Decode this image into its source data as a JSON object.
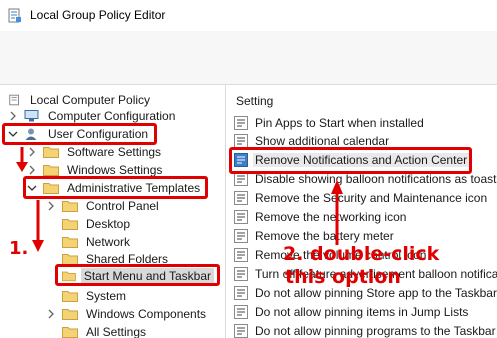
{
  "window": {
    "title": "Local Group Policy Editor",
    "app_icon": "policy-editor-icon"
  },
  "tree": {
    "items": [
      {
        "label": "Local Computer Policy",
        "icon": "computer-policy-icon"
      },
      {
        "label": "Computer Configuration",
        "icon": "computer-icon"
      },
      {
        "label": "User Configuration",
        "icon": "user-icon"
      },
      {
        "label": "Software Settings",
        "icon": "folder-icon"
      },
      {
        "label": "Windows Settings",
        "icon": "folder-icon"
      },
      {
        "label": "Administrative Templates",
        "icon": "folder-icon"
      },
      {
        "label": "Control Panel",
        "icon": "folder-icon"
      },
      {
        "label": "Desktop",
        "icon": "folder-icon"
      },
      {
        "label": "Network",
        "icon": "folder-icon"
      },
      {
        "label": "Shared Folders",
        "icon": "folder-icon"
      },
      {
        "label": "Start Menu and Taskbar",
        "icon": "folder-icon"
      },
      {
        "label": "System",
        "icon": "folder-icon"
      },
      {
        "label": "Windows Components",
        "icon": "folder-icon"
      },
      {
        "label": "All Settings",
        "icon": "folder-icon"
      }
    ],
    "selected": "Start Menu and Taskbar"
  },
  "list": {
    "header": "Setting",
    "items": [
      "Pin Apps to Start when installed",
      "Show additional calendar",
      "Remove Notifications and Action Center",
      "Disable showing balloon notifications as toasts",
      "Remove the Security and Maintenance icon",
      "Remove the networking icon",
      "Remove the battery meter",
      "Remove the volume control icon",
      "Turn off feature advertisement balloon notifications",
      "Do not allow pinning Store app to the Taskbar",
      "Do not allow pinning items in Jump Lists",
      "Do not allow pinning programs to the Taskbar"
    ],
    "selected": "Remove Notifications and Action Center"
  },
  "annotations": {
    "step1": "1.",
    "step2_line1": "2. double-click",
    "step2_line2": "this option",
    "color": "#e00000"
  }
}
